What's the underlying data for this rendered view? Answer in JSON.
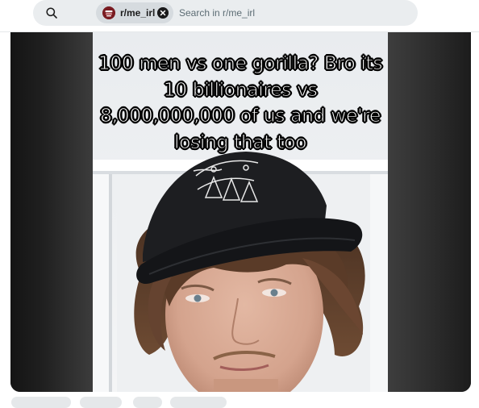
{
  "search": {
    "community_chip": "r/me_irl",
    "placeholder": "Search in r/me_irl"
  },
  "post": {
    "video_caption": "100 men vs one gorilla? Bro its 10 billionaires vs 8,000,000,000 of us and we're losing that too"
  },
  "colors": {
    "searchbar_bg": "#eaedef",
    "chip_bg": "#d6dbdf",
    "media_bg": "#131313"
  },
  "icons": {
    "search": "search-icon",
    "chip_avatar": "subreddit-avatar-icon",
    "chip_close": "close-icon"
  }
}
